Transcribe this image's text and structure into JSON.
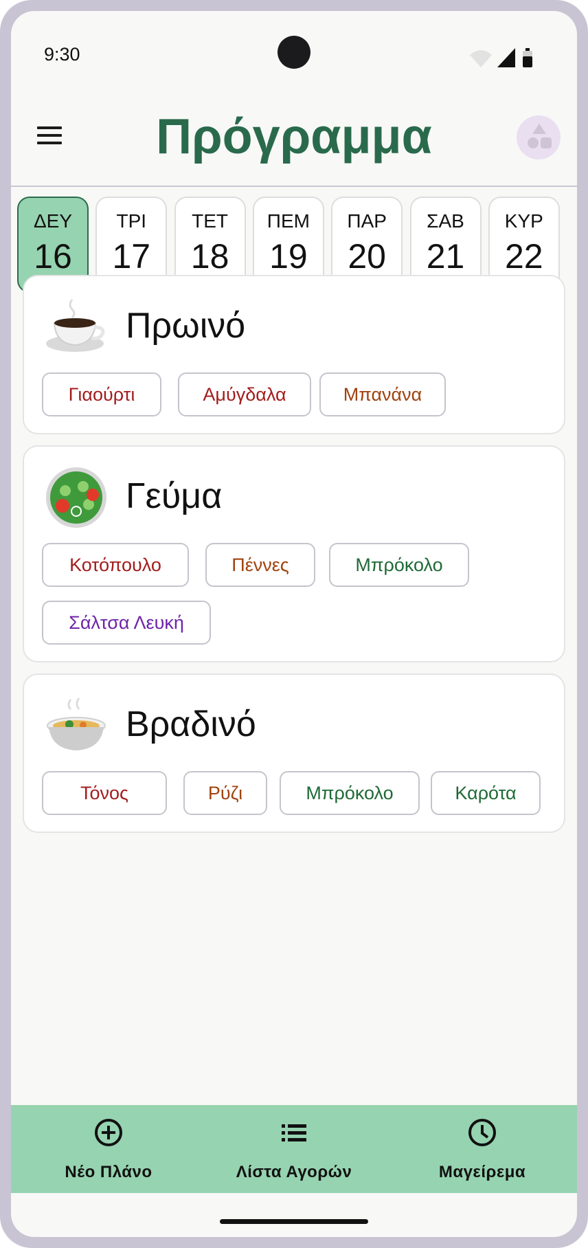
{
  "status": {
    "time": "9:30"
  },
  "header": {
    "title": "Πρόγραμμα"
  },
  "days": [
    {
      "name": "ΔΕΥ",
      "date": "16",
      "selected": true
    },
    {
      "name": "ΤΡΙ",
      "date": "17"
    },
    {
      "name": "ΤΕΤ",
      "date": "18"
    },
    {
      "name": "ΠΕΜ",
      "date": "19"
    },
    {
      "name": "ΠΑΡ",
      "date": "20"
    },
    {
      "name": "ΣΑΒ",
      "date": "21"
    },
    {
      "name": "ΚΥΡ",
      "date": "22"
    }
  ],
  "meals": [
    {
      "title": "Πρωινό",
      "icon": "coffee-cup-icon",
      "items": [
        {
          "label": "Γιαούρτι",
          "color": "#a31d1d"
        },
        {
          "label": "Αμύγδαλα",
          "color": "#a31d1d"
        },
        {
          "label": "Μπανάνα",
          "color": "#a1420e"
        }
      ]
    },
    {
      "title": "Γεύμα",
      "icon": "salad-icon",
      "items": [
        {
          "label": "Κοτόπουλο",
          "color": "#a31d1d"
        },
        {
          "label": "Πέννες",
          "color": "#a1420e"
        },
        {
          "label": "Μπρόκολο",
          "color": "#1f6a36"
        },
        {
          "label": "Σάλτσα Λευκή",
          "color": "#6e25a8"
        }
      ]
    },
    {
      "title": "Βραδινό",
      "icon": "soup-bowl-icon",
      "items": [
        {
          "label": "Τόνος",
          "color": "#a31d1d"
        },
        {
          "label": "Ρύζι",
          "color": "#a1420e"
        },
        {
          "label": "Μπρόκολο",
          "color": "#1f6a36"
        },
        {
          "label": "Καρότα",
          "color": "#1f6a36"
        }
      ]
    }
  ],
  "bottom_nav": [
    {
      "label": "Νέο Πλάνο",
      "icon": "add-circle-icon"
    },
    {
      "label": "Λίστα Αγορών",
      "icon": "list-icon"
    },
    {
      "label": "Μαγείρεμα",
      "icon": "clock-icon"
    }
  ],
  "colors": {
    "accent": "#2a6a4c",
    "selected_bg": "#96d3b0",
    "nav_bg": "#96d3b0"
  }
}
